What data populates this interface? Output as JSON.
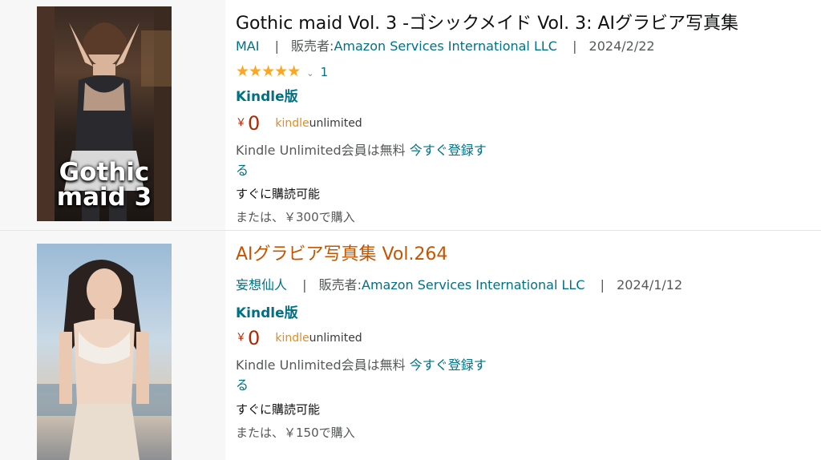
{
  "results": [
    {
      "title": "Gothic maid Vol. 3 -ゴシックメイド Vol. 3: AIグラビア写真集",
      "author": "MAI",
      "seller_label": "販売者:",
      "seller": "Amazon Services International LLC",
      "date": "2024/2/22",
      "rating_stars": "★★★★★",
      "rating_count": "1",
      "format": "Kindle版",
      "currency": "￥",
      "price": "0",
      "ku_logo_a": "kindle",
      "ku_logo_b": "unlimited",
      "promo_text": "Kindle Unlimited会員は無料 ",
      "promo_link": "今すぐ登録する",
      "availability": "すぐに購読可能",
      "buy_text": "または、￥300で購入",
      "cover_text": "Gothic maid 3"
    },
    {
      "title": "AIグラビア写真集 Vol.264",
      "author": "妄想仙人",
      "seller_label": "販売者:",
      "seller": "Amazon Services International LLC",
      "date": "2024/1/12",
      "format": "Kindle版",
      "currency": "￥",
      "price": "0",
      "ku_logo_a": "kindle",
      "ku_logo_b": "unlimited",
      "promo_text": "Kindle Unlimited会員は無料 ",
      "promo_link": "今すぐ登録する",
      "availability": "すぐに購読可能",
      "buy_text": "または、￥150で購入"
    }
  ],
  "colors": {
    "link": "#007185",
    "price": "#b12704",
    "star": "#ffa41c",
    "title_hover": "#c45500"
  }
}
